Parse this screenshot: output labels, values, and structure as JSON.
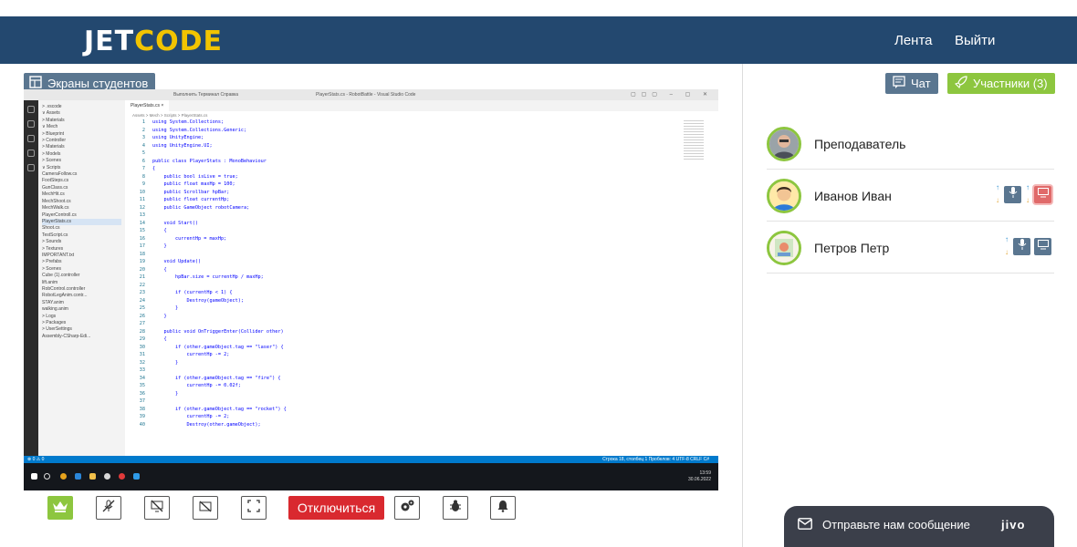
{
  "header": {
    "logo_left": "JET",
    "logo_right": "CODE",
    "nav_feed": "Лента",
    "nav_logout": "Выйти"
  },
  "left": {
    "screens_button": "Экраны студентов",
    "controls": {
      "disconnect": "Отключиться"
    }
  },
  "shared_screen": {
    "titlebar_menu": "Выполнить   Терминал   Справка",
    "window_title": "PlayerStats.cs - RobotBattle - Visual Studio Code",
    "tab": "PlayerStats.cs ×",
    "breadcrumbs": "Assets > Mech > Scripts > PlayerStats.cs",
    "explorer": [
      "> .vscode",
      "∨ Assets",
      "> Materials",
      "∨ Mech",
      "> Blueprint",
      "> Controller",
      "> Materials",
      "> Models",
      "> Scenes",
      "∨ Scripts",
      "CameraFollow.cs",
      "FootSteps.cs",
      "GunClass.cs",
      "MechHit.cs",
      "MechShoot.cs",
      "MechWalk.cs",
      "PlayerControll.cs",
      "PlayerStats.cs",
      "Shoot.cs",
      "TestScript.cs",
      "> Sounds",
      "> Textures",
      "IMPORTANT.txt",
      "> Prefabs",
      "> Scenes",
      "Cube (1).controller",
      "lift.anim",
      "RobControl.controller",
      "RobotLegAnim.contr...",
      "STAY.anim",
      "walking.anim",
      "> Logs",
      "> Packages",
      "> UserSettings",
      "Assembly-CSharp-Edi..."
    ],
    "code_lines": [
      "using System.Collections;",
      "using System.Collections.Generic;",
      "using UnityEngine;",
      "using UnityEngine.UI;",
      "",
      "public class PlayerStats : MonoBehaviour",
      "{",
      "    public bool isLive = true;",
      "    public float maxHp = 100;",
      "    public Scrollbar hpBar;",
      "    public float currentHp;",
      "    public GameObject robotCamera;",
      "",
      "    void Start()",
      "    {",
      "        currentHp = maxHp;",
      "    }",
      "",
      "    void Update()",
      "    {",
      "        hpBar.size = currentHp / maxHp;",
      "",
      "        if (currentHp < 1) {",
      "            Destroy(gameObject);",
      "        }",
      "    }",
      "",
      "    public void OnTriggerEnter(Collider other)",
      "    {",
      "        if (other.gameObject.tag == \"laser\") {",
      "            currentHp -= 2;",
      "        }",
      "",
      "        if (other.gameObject.tag == \"fire\") {",
      "            currentHp -= 0.02f;",
      "        }",
      "",
      "        if (other.gameObject.tag == \"rocket\") {",
      "            currentHp -= 2;",
      "            Destroy(other.gameObject);"
    ],
    "status_left": "⊗ 0 ⚠ 0",
    "status_right": "Строка 18, столбец 1   Пробелов: 4   UTF-8   CRLF   C#",
    "clock_time": "13:59",
    "clock_date": "30.06.2022"
  },
  "right": {
    "chat_button": "Чат",
    "members_button": "Участники (3)",
    "participants": [
      {
        "name": "Преподаватель"
      },
      {
        "name": "Иванов Иван"
      },
      {
        "name": "Петров Петр"
      }
    ]
  },
  "jivo": {
    "text": "Отправьте нам сообщение",
    "brand": "jivo"
  },
  "colors": {
    "header": "#23486f",
    "accent_yellow": "#f2c400",
    "green": "#8dc63f",
    "slate": "#5a7690",
    "red": "#d9292f",
    "vscode_blue": "#007acc"
  }
}
